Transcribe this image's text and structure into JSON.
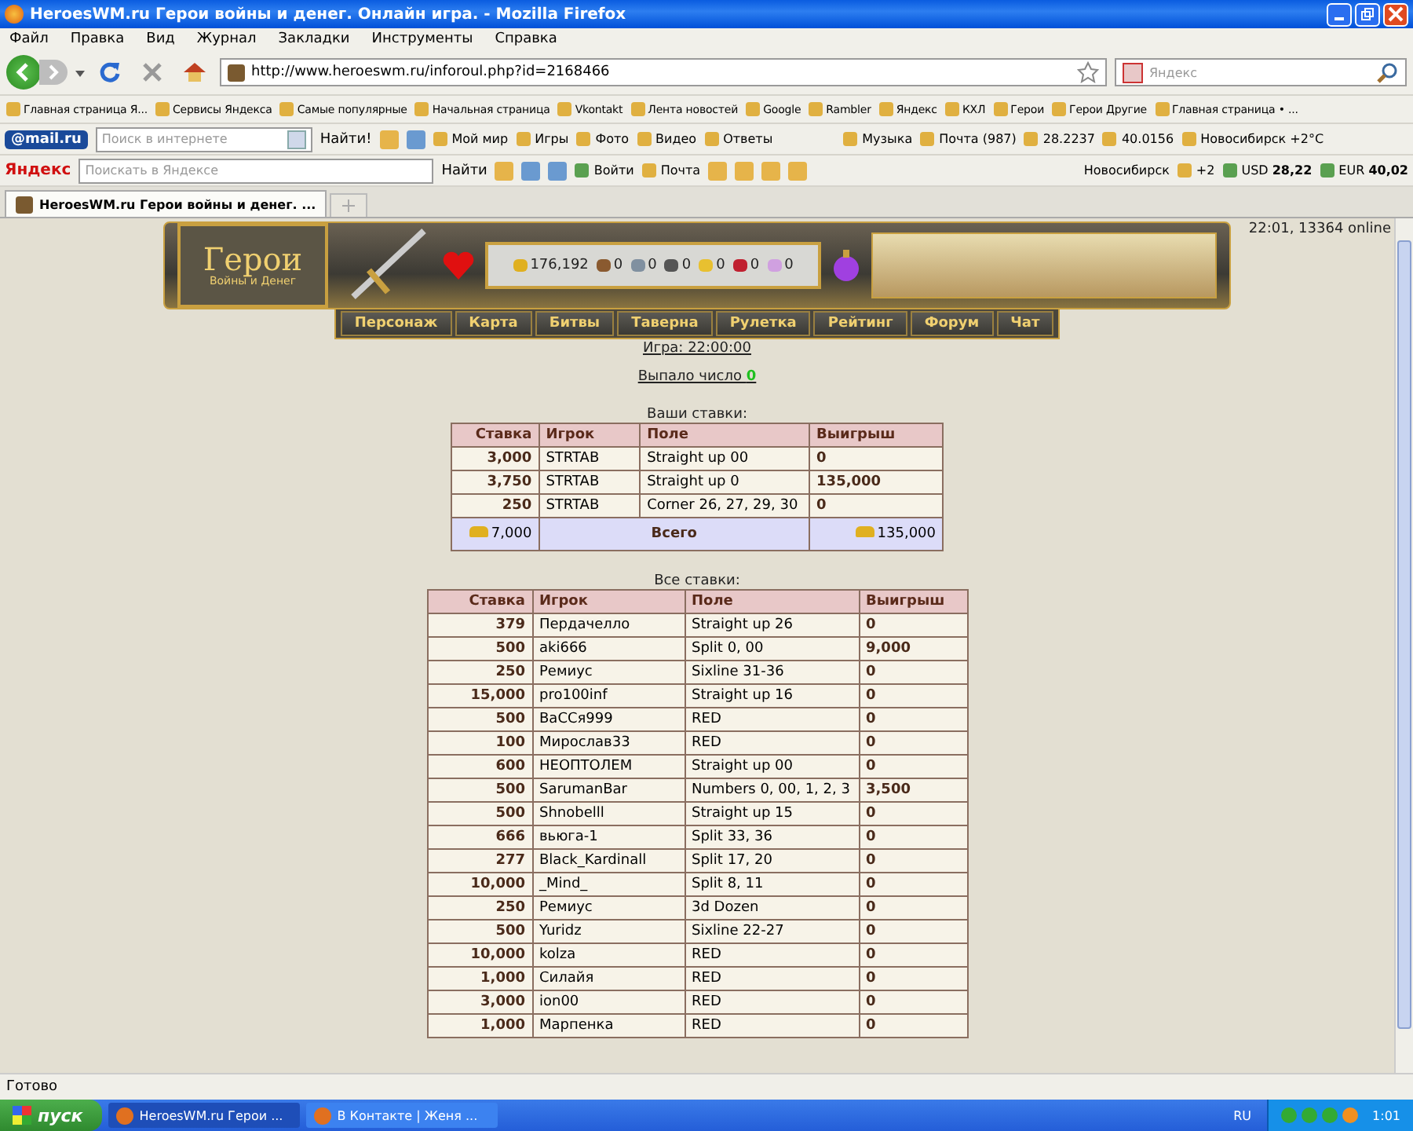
{
  "window": {
    "title": "HeroesWM.ru Герои войны и денег. Онлайн игра. - Mozilla Firefox"
  },
  "menu": [
    "Файл",
    "Правка",
    "Вид",
    "Журнал",
    "Закладки",
    "Инструменты",
    "Справка"
  ],
  "nav": {
    "url": "http://www.heroeswm.ru/inforoul.php?id=2168466",
    "search_placeholder": "Яндекс"
  },
  "bookmarks": [
    "Главная страница Я...",
    "Сервисы Яндекса",
    "Самые популярные",
    "Начальная страница",
    "Vkontakt",
    "Лента новостей",
    "Google",
    "Rambler",
    "Яндекс",
    "КХЛ",
    "Герои",
    "Герои Другие",
    "Главная страница • ..."
  ],
  "mail_toolbar": {
    "logo": "@mail.ru",
    "search_placeholder": "Поиск в интернете",
    "find": "Найти!",
    "items": [
      "Мой мир",
      "Игры",
      "Фото",
      "Видео",
      "Ответы",
      "Музыка",
      "Почта (987)",
      "28.2237",
      "40.0156",
      "Новосибирск +2°C"
    ]
  },
  "yandex_toolbar": {
    "logo": "Яндекс",
    "search_placeholder": "Поискать в Яндексе",
    "find": "Найти",
    "login": "Войти",
    "mail": "Почта",
    "city": "Новосибирск",
    "temperature": "+2",
    "usd": "USD **28,22**",
    "eur": "EUR **40,02**"
  },
  "tabs": [
    {
      "label": "HeroesWM.ru Герои войны и денег. ...",
      "selected": true
    }
  ],
  "game": {
    "logo": "Герои",
    "logo_subtitle": "Войны и Денег",
    "resources": [
      "176,192",
      "0",
      "0",
      "0",
      "0",
      "0",
      "0"
    ],
    "server_info": "22:01, 13364 online",
    "menu": [
      "Персонаж",
      "Карта",
      "Битвы",
      "Таверна",
      "Рулетка",
      "Рейтинг",
      "Форум",
      "Чат"
    ]
  },
  "game_time": "Игра: 22:00:00",
  "result": {
    "label": "Выпало число",
    "number": "0"
  },
  "my_bets": {
    "caption": "Ваши ставки:",
    "columns": [
      "Ставка",
      "Игрок",
      "Поле",
      "Выигрыш"
    ],
    "rows": [
      [
        "3,000",
        "STRTAB",
        "Straight up 00",
        "0"
      ],
      [
        "3,750",
        "STRTAB",
        "Straight up 0",
        "135,000"
      ],
      [
        "250",
        "STRTAB",
        "Corner 26, 27, 29, 30",
        "0"
      ]
    ],
    "total": {
      "stake": "7,000",
      "label": "Всего",
      "win": "135,000"
    }
  },
  "all_bets": {
    "caption": "Все ставки:",
    "columns": [
      "Ставка",
      "Игрок",
      "Поле",
      "Выигрыш"
    ],
    "rows": [
      [
        "379",
        "Пердачелло",
        "Straight up 26",
        "0"
      ],
      [
        "500",
        "aki666",
        "Split 0, 00",
        "9,000"
      ],
      [
        "250",
        "Ремиус",
        "Sixline 31-36",
        "0"
      ],
      [
        "15,000",
        "pro100inf",
        "Straight up 16",
        "0"
      ],
      [
        "500",
        "ВаССя999",
        "RED",
        "0"
      ],
      [
        "100",
        "Мирослав33",
        "RED",
        "0"
      ],
      [
        "600",
        "НЕОПТОЛЕМ",
        "Straight up 00",
        "0"
      ],
      [
        "500",
        "SarumanBar",
        "Numbers 0, 00, 1, 2, 3",
        "3,500"
      ],
      [
        "500",
        "Shnobelll",
        "Straight up 15",
        "0"
      ],
      [
        "666",
        "вьюга-1",
        "Split 33, 36",
        "0"
      ],
      [
        "277",
        "Black_Kardinall",
        "Split 17, 20",
        "0"
      ],
      [
        "10,000",
        "_Mind_",
        "Split 8, 11",
        "0"
      ],
      [
        "250",
        "Ремиус",
        "3d Dozen",
        "0"
      ],
      [
        "500",
        "Yuridz",
        "Sixline 22-27",
        "0"
      ],
      [
        "10,000",
        "kolza",
        "RED",
        "0"
      ],
      [
        "1,000",
        "Силайя",
        "RED",
        "0"
      ],
      [
        "3,000",
        "ion00",
        "RED",
        "0"
      ],
      [
        "1,000",
        "Марпенка",
        "RED",
        "0"
      ]
    ]
  },
  "status_bar": "Готово",
  "taskbar": {
    "start": "пуск",
    "tasks": [
      {
        "label": "HeroesWM.ru Герои ...",
        "selected": true
      },
      {
        "label": "В Контакте | Женя ...",
        "selected": false
      }
    ],
    "language": "RU",
    "clock": "1:01"
  }
}
